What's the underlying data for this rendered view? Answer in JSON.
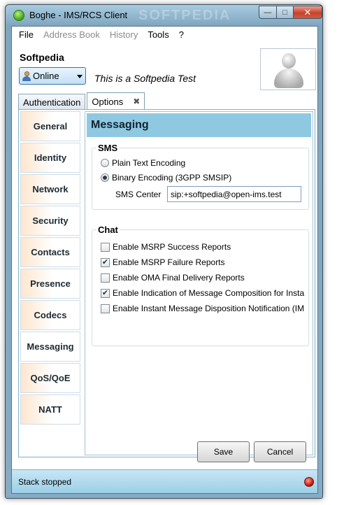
{
  "window": {
    "title": "Boghe - IMS/RCS Client",
    "watermark": "SOFTPEDIA",
    "controls": {
      "minimize": "—",
      "maximize": "□",
      "close": "✕"
    }
  },
  "menu": {
    "items": [
      {
        "label": "File",
        "enabled": true
      },
      {
        "label": "Address Book",
        "enabled": false
      },
      {
        "label": "History",
        "enabled": false
      },
      {
        "label": "Tools",
        "enabled": true
      },
      {
        "label": "?",
        "enabled": true
      }
    ]
  },
  "profile": {
    "name": "Softpedia",
    "status": "Online",
    "free_text": "This is a Softpedia Test"
  },
  "tabs": [
    {
      "label": "Authentication"
    },
    {
      "label": "Options",
      "close": "✖"
    }
  ],
  "nav": {
    "items": [
      {
        "label": "General"
      },
      {
        "label": "Identity"
      },
      {
        "label": "Network"
      },
      {
        "label": "Security"
      },
      {
        "label": "Contacts"
      },
      {
        "label": "Presence"
      },
      {
        "label": "Codecs"
      },
      {
        "label": "Messaging"
      },
      {
        "label": "QoS/QoE"
      },
      {
        "label": "NATT"
      }
    ],
    "active": "Messaging"
  },
  "messaging": {
    "header": "Messaging",
    "sms": {
      "title": "SMS",
      "encoding_options": [
        {
          "label": "Plain Text Encoding",
          "selected": false
        },
        {
          "label": "Binary Encoding (3GPP SMSIP)",
          "selected": true
        }
      ],
      "center_label": "SMS Center",
      "center_value": "sip:+softpedia@open-ims.test"
    },
    "chat": {
      "title": "Chat",
      "options": [
        {
          "label": "Enable MSRP Success Reports",
          "checked": false
        },
        {
          "label": "Enable MSRP Failure Reports",
          "checked": true
        },
        {
          "label": "Enable OMA Final Delivery Reports",
          "checked": false
        },
        {
          "label": "Enable Indication of Message Composition for Insta",
          "checked": true
        },
        {
          "label": "Enable Instant Message Disposition Notification (IM",
          "checked": false
        }
      ]
    }
  },
  "buttons": {
    "save": "Save",
    "cancel": "Cancel"
  },
  "statusbar": {
    "text": "Stack stopped"
  },
  "colors": {
    "header_bg": "#8fc9e1",
    "status_led": "#d11c0e",
    "statusbar_bg": "#b3dbee"
  }
}
